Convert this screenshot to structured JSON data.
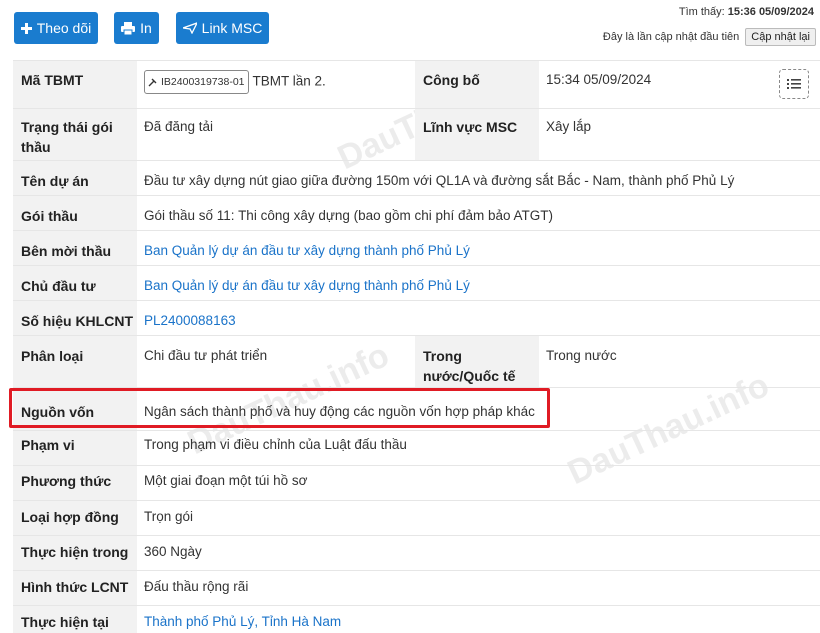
{
  "toolbar": {
    "follow_label": "Theo dõi",
    "print_label": "In",
    "link_label": "Link MSC"
  },
  "status": {
    "found_label": "Tìm thấy:",
    "found_time": "15:36 05/09/2024",
    "update_note": "Đây là lần cập nhật đầu tiên",
    "update_button": "Cập nhật lại"
  },
  "watermark": "DauThau.info",
  "rows": [
    {
      "label": "Mã TBMT",
      "tag": "IB2400319738-01",
      "value": "TBMT lần 2.",
      "label2": "Công bố",
      "value2": "15:34 05/09/2024"
    },
    {
      "label_l1": "Trạng thái gói",
      "label_l2": "thầu",
      "value": "Đã đăng tải",
      "label2": "Lĩnh vực MSC",
      "value2": "Xây lắp"
    },
    {
      "label": "Tên dự án",
      "value": "Đầu tư xây dựng nút giao giữa đường 150m với QL1A và đường sắt Bắc - Nam, thành phố Phủ Lý"
    },
    {
      "label": "Gói thầu",
      "value": "Gói thầu số 11: Thi công xây dựng (bao gồm chi phí đảm bảo ATGT)"
    },
    {
      "label": "Bên mời thầu",
      "value": "Ban Quản lý dự án đầu tư xây dựng thành phố Phủ Lý"
    },
    {
      "label": "Chủ đầu tư",
      "value": "Ban Quản lý dự án đầu tư xây dựng thành phố Phủ Lý"
    },
    {
      "label": "Số hiệu KHLCNT",
      "value": "PL2400088163"
    },
    {
      "label": "Phân loại",
      "value": "Chi đầu tư phát triển",
      "label2_l1": "Trong",
      "label2_l2": "nước/Quốc tế",
      "value2": "Trong nước"
    },
    {
      "label": "Nguồn vốn",
      "value": "Ngân sách thành phố và huy động các nguồn vốn hợp pháp khác"
    },
    {
      "label": "Phạm vi",
      "value": "Trong phạm vi điều chỉnh của Luật đấu thầu"
    },
    {
      "label": "Phương thức",
      "value": "Một giai đoạn một túi hồ sơ"
    },
    {
      "label": "Loại hợp đồng",
      "value": "Trọn gói"
    },
    {
      "label": "Thực hiện trong",
      "value": "360 Ngày"
    },
    {
      "label": "Hình thức LCNT",
      "value": "Đấu thầu rộng rãi"
    },
    {
      "label": "Thực hiện tại",
      "value": "Thành phố Phủ Lý, Tỉnh Hà Nam"
    }
  ],
  "colors": {
    "accent": "#1a7ccf",
    "link": "#1a73c9",
    "highlight": "#e01b24"
  }
}
